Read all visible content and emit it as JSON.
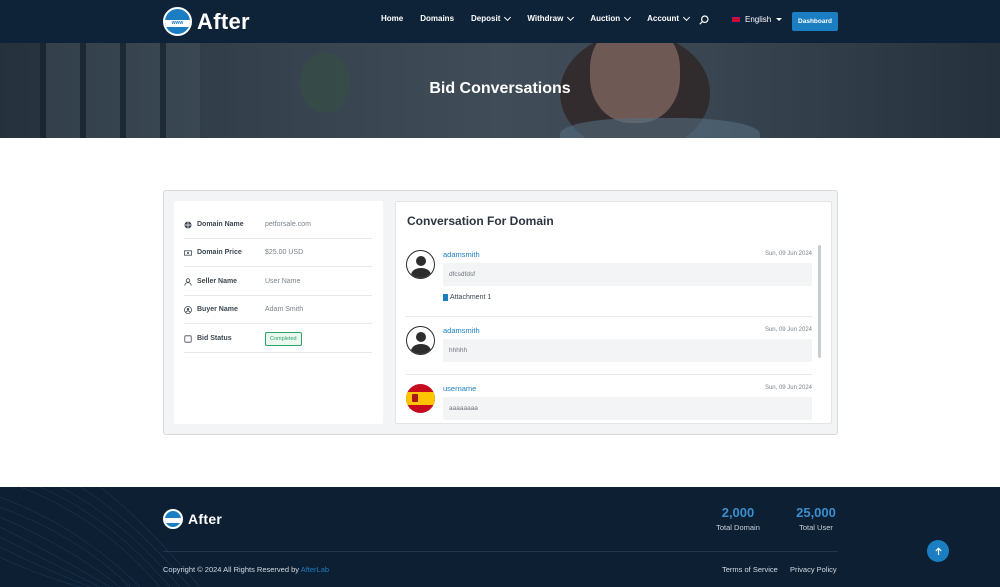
{
  "brand": {
    "name": "After",
    "globe_text": "www"
  },
  "nav": {
    "items": [
      {
        "label": "Home",
        "has_dropdown": false
      },
      {
        "label": "Domains",
        "has_dropdown": false
      },
      {
        "label": "Deposit",
        "has_dropdown": true
      },
      {
        "label": "Withdraw",
        "has_dropdown": true
      },
      {
        "label": "Auction",
        "has_dropdown": true
      },
      {
        "label": "Account",
        "has_dropdown": true
      }
    ],
    "search_icon": "search-icon",
    "language": "English",
    "dashboard_label": "Dashboard"
  },
  "hero": {
    "title": "Bid Conversations"
  },
  "bid_info": {
    "rows": [
      {
        "icon": "globe-icon",
        "label": "Domain Name",
        "value": "petforsale.com"
      },
      {
        "icon": "money-icon",
        "label": "Domain Price",
        "value": "$25.00 USD"
      },
      {
        "icon": "user-icon",
        "label": "Seller Name",
        "value": "User Name"
      },
      {
        "icon": "user-circle-icon",
        "label": "Buyer Name",
        "value": "Adam Smith"
      },
      {
        "icon": "checkbox-icon",
        "label": "Bid Status",
        "value": "Completed"
      }
    ]
  },
  "conversation": {
    "title": "Conversation For Domain",
    "messages": [
      {
        "user": "adamsmith",
        "date": "Sun, 09 Jun 2024",
        "text": "dfcsdfdsf",
        "attachment": "Attachment 1",
        "avatar": "default"
      },
      {
        "user": "adamsmith",
        "date": "Sun, 09 Jun 2024",
        "text": "hhhhh",
        "avatar": "default"
      },
      {
        "user": "username",
        "date": "Sun, 09 Jun 2024",
        "text": "aaaaaaaa",
        "avatar": "spain-flag"
      }
    ]
  },
  "footer": {
    "brand": "After",
    "stats": [
      {
        "value": "2,000",
        "label": "Total Domain"
      },
      {
        "value": "25,000",
        "label": "Total User"
      }
    ],
    "copyright": "Copyright © 2024 All Rights Reserved by",
    "copyright_brand": "AfterLab",
    "links": [
      "Terms of Service",
      "Privacy Policy"
    ]
  },
  "colors": {
    "navbar": "#0e2238",
    "accent": "#1b7ec2",
    "footer": "#0c1f33",
    "success": "#2aa567"
  }
}
